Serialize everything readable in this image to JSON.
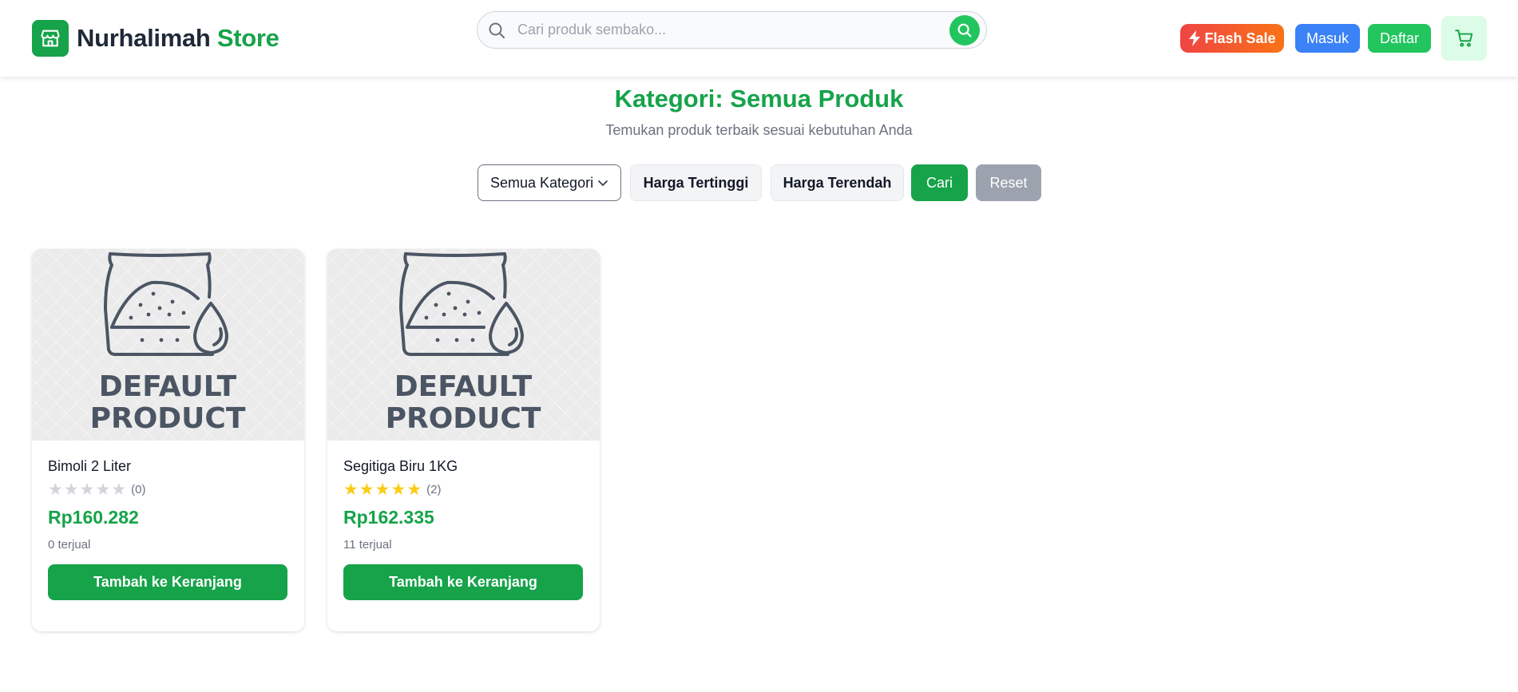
{
  "header": {
    "brand_name": "Nurhalimah",
    "brand_store": "Store",
    "logo_icon": "store-icon",
    "search": {
      "placeholder": "Cari produk sembako...",
      "value": ""
    },
    "flash_sale_label": "Flash Sale",
    "login_label": "Masuk",
    "register_label": "Daftar",
    "cart_icon": "cart-icon"
  },
  "main": {
    "title": "Kategori: Semua Produk",
    "subtitle": "Temukan produk terbaik sesuai kebutuhan Anda"
  },
  "filters": {
    "category_selected": "Semua Kategori",
    "sort_high_label": "Harga Tertinggi",
    "sort_low_label": "Harga Terendah",
    "search_label": "Cari",
    "reset_label": "Reset"
  },
  "products": [
    {
      "image_text_1": "DEFAULT",
      "image_text_2": "PRODUCT",
      "name": "Bimoli 2 Liter",
      "rating": 0,
      "rating_count": "(0)",
      "price": "Rp160.282",
      "sold": "0 terjual",
      "add_label": "Tambah ke Keranjang"
    },
    {
      "image_text_1": "DEFAULT",
      "image_text_2": "PRODUCT",
      "name": "Segitiga Biru 1KG",
      "rating": 5,
      "rating_count": "(2)",
      "price": "Rp162.335",
      "sold": "11 terjual",
      "add_label": "Tambah ke Keranjang"
    }
  ],
  "colors": {
    "primary": "#16a34a",
    "accent_green": "#22c55e",
    "blue": "#3b82f6",
    "flash_start": "#ef4444",
    "flash_end": "#f97316",
    "star": "#facc15"
  }
}
